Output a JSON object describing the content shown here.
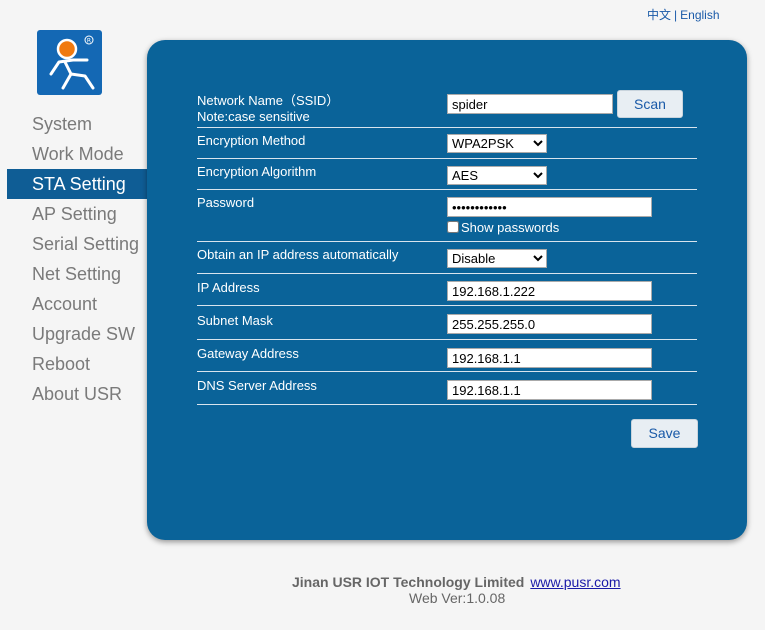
{
  "lang": {
    "chinese": "中文",
    "separator": "|",
    "english": "English"
  },
  "menu": [
    {
      "label": "System"
    },
    {
      "label": "Work Mode"
    },
    {
      "label": "STA Setting"
    },
    {
      "label": "AP Setting"
    },
    {
      "label": "Serial Setting"
    },
    {
      "label": "Net Setting"
    },
    {
      "label": "Account"
    },
    {
      "label": "Upgrade SW"
    },
    {
      "label": "Reboot"
    },
    {
      "label": "About USR"
    }
  ],
  "active_menu": "STA Setting",
  "form": {
    "ssid_label": "Network Name（SSID）",
    "ssid_note": "Note:case sensitive",
    "ssid_value": "spider",
    "scan_label": "Scan",
    "enc_method_label": "Encryption Method",
    "enc_method_value": "WPA2PSK",
    "enc_alg_label": "Encryption Algorithm",
    "enc_alg_value": "AES",
    "password_label": "Password",
    "password_value": "••••••••••••",
    "show_passwords_label": "Show passwords",
    "dhcp_label": "Obtain an IP address automatically",
    "dhcp_value": "Disable",
    "ip_label": "IP Address",
    "ip_value": "192.168.1.222",
    "mask_label": "Subnet Mask",
    "mask_value": "255.255.255.0",
    "gateway_label": "Gateway Address",
    "gateway_value": "192.168.1.1",
    "dns_label": "DNS Server Address",
    "dns_value": "192.168.1.1",
    "save_label": "Save"
  },
  "footer": {
    "company": "Jinan USR IOT Technology Limited",
    "link": "www.pusr.com",
    "version": "Web Ver:1.0.08"
  },
  "colors": {
    "panel": "#0a6399",
    "active_menu": "#0f5d95",
    "logo": "#1468b4",
    "logo_accent": "#f07a10"
  }
}
